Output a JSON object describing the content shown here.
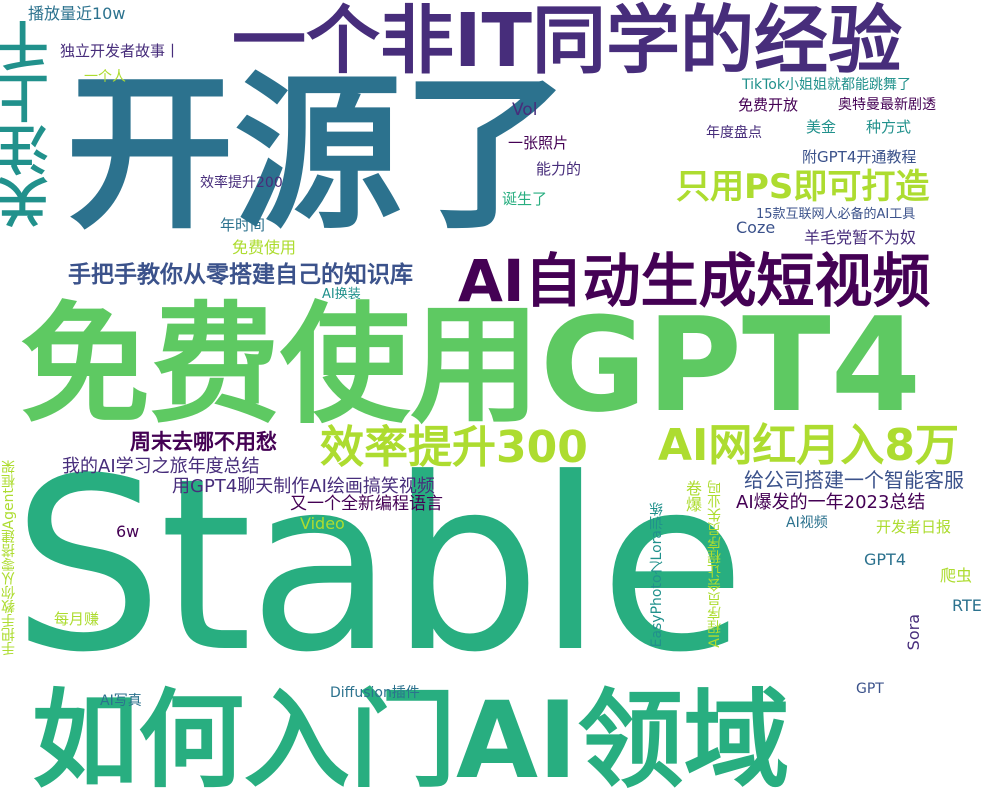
{
  "words": {
    "stable": "Stable",
    "kaiyuan_le": "开源了",
    "mianfei_gpt4": "免费使用GPT4",
    "ruhe_ai": "如何入门AI领域",
    "fei_it": "一个非IT同学的经验",
    "ai_duanshipin": "AI自动生成短视频",
    "guanzhu": "关注上千",
    "zhiyong_ps": "只用PS即可打造",
    "xiaolv_300": "效率提升300",
    "ai_wanghong": "AI网红月入8万",
    "zhishiku": "手把手教你从零搭建自己的知识库",
    "zhoumo": "周末去哪不用愁",
    "xuexi_nianzhong": "我的AI学习之旅年度总结",
    "gpt4_gaoxiao": "用GPT4聊天制作AI绘画搞笑视频",
    "xin_yuyan": "又一个全新编程语言",
    "zhineng_kefu": "给公司搭建一个智能客服",
    "ai_2023": "AI爆发的一年2023总结",
    "bofang": "播放量近10w",
    "duli_kaifa": "独立开发者故事丨",
    "yige_ren": "一个人",
    "tiktok": "TikTok小姐姐就都能跳舞了",
    "mianfei_kaifang": "免费开放",
    "aoteman": "奥特曼最新剧透",
    "vol": "Vol",
    "meijin": "美金",
    "zhong_fangshi": "种方式",
    "niandu_pandian": "年度盘点",
    "yizhang_zhaopian": "一张照片",
    "nengli_de": "能力的",
    "fu_gpt4": "附GPT4开通教程",
    "xiaolv_200": "效率提升200",
    "dansheng_le": "诞生了",
    "ai_gongju": "15款互联网人必备的AI工具",
    "nian_shijian": "年时间",
    "mianfei_shiyong": "免费使用",
    "coze": "Coze",
    "yangmao": "羊毛党暂不为奴",
    "ai_huanzhuang": "AI换装",
    "juan_bao": "卷爆",
    "easyphoto": "EasyPhoto之Lora训练",
    "ai_chengxuyuan": "AI程序员会让程序员失业吗",
    "agent": "手把手教你从零搭建Agent框架",
    "video": "Video",
    "six_w": "6w",
    "ai_shipin": "AI视频",
    "kaifazhe_ribao": "开发者日报",
    "gpt4": "GPT4",
    "pachong": "爬虫",
    "rte": "RTE",
    "sora": "Sora",
    "meiyue_zhuan": "每月赚",
    "ai_xiezhen": "AI写真",
    "diffusion": "Diffusion插件",
    "gpt": "GPT"
  },
  "colors": {
    "dark_purple": "#440154",
    "purple": "#472d7b",
    "indigo": "#3b528b",
    "blue": "#2c728e",
    "teal": "#21918c",
    "green_teal": "#28ae80",
    "green": "#5ec962",
    "light_green": "#addc30",
    "yellow": "#dde318"
  }
}
